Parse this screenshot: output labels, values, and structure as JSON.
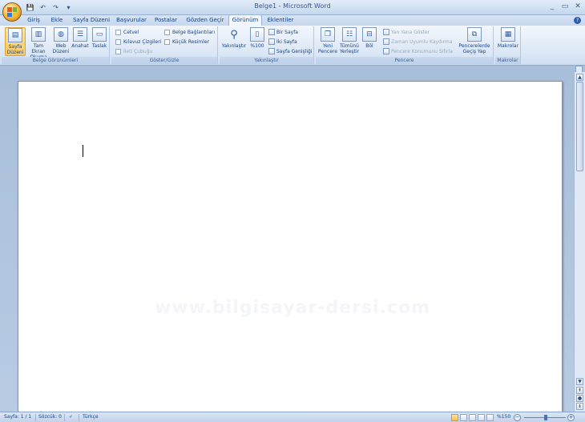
{
  "window": {
    "title": "Belge1 - Microsoft Word",
    "minimize": "_",
    "restore": "▭",
    "close": "✕"
  },
  "qat": {
    "save": "💾",
    "undo": "↶",
    "redo": "↷",
    "customize": "▾"
  },
  "tabs": [
    {
      "label": "Giriş"
    },
    {
      "label": "Ekle"
    },
    {
      "label": "Sayfa Düzeni"
    },
    {
      "label": "Başvurular"
    },
    {
      "label": "Postalar"
    },
    {
      "label": "Gözden Geçir"
    },
    {
      "label": "Görünüm"
    },
    {
      "label": "Eklentiler"
    }
  ],
  "active_tab": "Görünüm",
  "help": "?",
  "ribbon": {
    "views": {
      "label": "Belge Görünümleri",
      "print_layout": "Sayfa Düzeni",
      "full_screen": "Tam Ekran Okuma",
      "web_layout": "Web Düzeni",
      "outline": "Anahat",
      "draft": "Taslak"
    },
    "show_hide": {
      "label": "Göster/Gizle",
      "ruler": "Cetvel",
      "gridlines": "Kılavuz Çizgileri",
      "message_bar": "İleti Çubuğu",
      "document_map": "Belge Bağlantıları",
      "thumbnails": "Küçük Resimler"
    },
    "zoom": {
      "label": "Yakınlaştır",
      "zoom": "Yakınlaştır",
      "hundred": "%100",
      "one_page": "Bir Sayfa",
      "two_pages": "İki Sayfa",
      "page_width": "Sayfa Genişliği"
    },
    "window": {
      "label": "Pencere",
      "new_window": "Yeni Pencere",
      "arrange_all": "Tümünü Yerleştir",
      "split": "Böl",
      "side_by_side": "Yan Yana Göster",
      "sync_scroll": "Zaman Uyumlu Kaydırma",
      "reset_position": "Pencere Konumunu Sıfırla",
      "switch_windows": "Pencerelerde Geçiş Yap"
    },
    "macros": {
      "label": "Makrolar",
      "macros": "Makrolar"
    }
  },
  "document": {
    "watermark": "www.bilgisayar-dersi.com"
  },
  "status": {
    "page": "Sayfa: 1 / 1",
    "words": "Sözcük: 0",
    "language": "Türkçe",
    "zoom": "%150"
  },
  "colors": {
    "accent": "#15428b",
    "ribbon_bg": "#dbe7f6",
    "workspace_bg": "#a9bed9",
    "selected": "#fbc95c"
  }
}
